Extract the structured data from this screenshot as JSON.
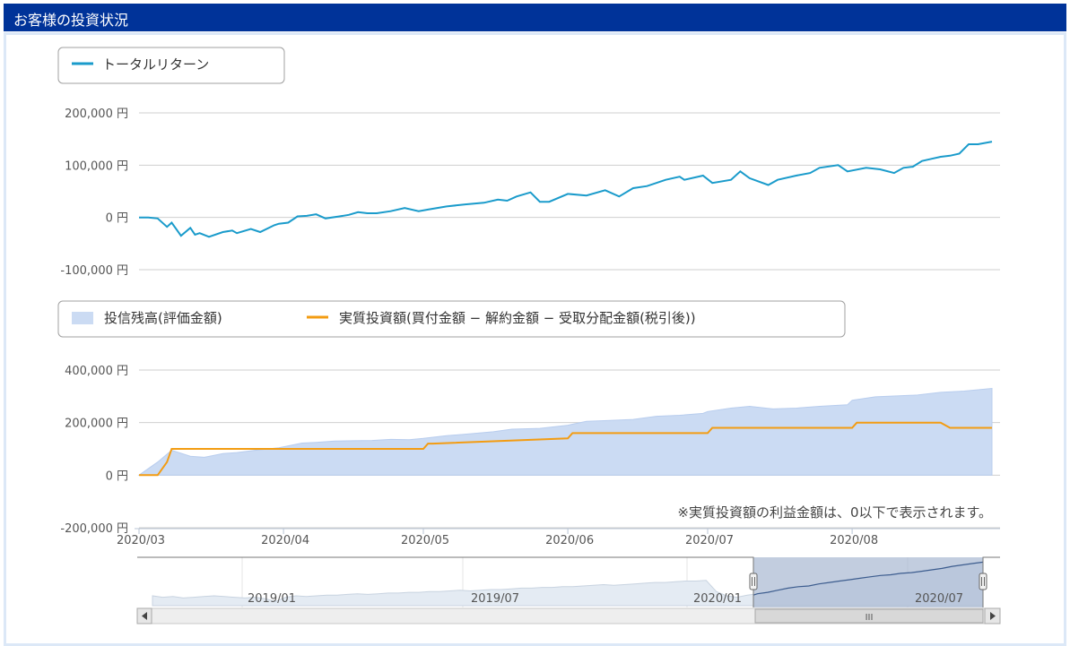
{
  "header": {
    "title": "お客様の投資状況"
  },
  "colors": {
    "header_bg": "#003399",
    "return_line": "#1a9bcb",
    "area_fill": "#cbdbf3",
    "net_line": "#f39c12"
  },
  "chart_data": [
    {
      "type": "line",
      "legend": [
        "トータルリターン"
      ],
      "y_ticks": [
        "200,000 円",
        "100,000 円",
        "0 円",
        "-100,000 円"
      ],
      "ylim": [
        -100000,
        200000
      ],
      "series": [
        {
          "name": "トータルリターン",
          "x": [
            "2020-03-01",
            "2020-03-03",
            "2020-03-05",
            "2020-03-07",
            "2020-03-08",
            "2020-03-10",
            "2020-03-12",
            "2020-03-13",
            "2020-03-14",
            "2020-03-16",
            "2020-03-19",
            "2020-03-21",
            "2020-03-22",
            "2020-03-25",
            "2020-03-27",
            "2020-03-30",
            "2020-03-31",
            "2020-04-02",
            "2020-04-04",
            "2020-04-06",
            "2020-04-08",
            "2020-04-10",
            "2020-04-13",
            "2020-04-15",
            "2020-04-17",
            "2020-04-19",
            "2020-04-21",
            "2020-04-24",
            "2020-04-27",
            "2020-04-30",
            "2020-05-02",
            "2020-05-06",
            "2020-05-10",
            "2020-05-14",
            "2020-05-17",
            "2020-05-19",
            "2020-05-21",
            "2020-05-24",
            "2020-05-26",
            "2020-05-28",
            "2020-06-01",
            "2020-06-05",
            "2020-06-09",
            "2020-06-12",
            "2020-06-15",
            "2020-06-18",
            "2020-06-22",
            "2020-06-25",
            "2020-06-26",
            "2020-06-30",
            "2020-07-02",
            "2020-07-06",
            "2020-07-08",
            "2020-07-10",
            "2020-07-14",
            "2020-07-16",
            "2020-07-20",
            "2020-07-23",
            "2020-07-25",
            "2020-07-29",
            "2020-07-31",
            "2020-08-04",
            "2020-08-07",
            "2020-08-10",
            "2020-08-12",
            "2020-08-14",
            "2020-08-16",
            "2020-08-18",
            "2020-08-20",
            "2020-08-22",
            "2020-08-24",
            "2020-08-26",
            "2020-08-28",
            "2020-08-31"
          ],
          "values": [
            0,
            0,
            -2000,
            -18000,
            -10000,
            -35000,
            -20000,
            -33000,
            -30000,
            -37000,
            -28000,
            -25000,
            -30000,
            -22000,
            -28000,
            -15000,
            -12000,
            -10000,
            2000,
            3000,
            6000,
            -2000,
            2000,
            5000,
            10000,
            8000,
            8000,
            12000,
            18000,
            12000,
            15000,
            21000,
            25000,
            28000,
            34000,
            32000,
            40000,
            48000,
            30000,
            30000,
            45000,
            42000,
            52000,
            40000,
            56000,
            60000,
            72000,
            78000,
            72000,
            80000,
            66000,
            72000,
            88000,
            75000,
            62000,
            72000,
            80000,
            85000,
            95000,
            100000,
            88000,
            95000,
            92000,
            85000,
            95000,
            97000,
            108000,
            112000,
            116000,
            118000,
            122000,
            140000,
            140000,
            145000
          ]
        }
      ]
    },
    {
      "type": "area",
      "legend": [
        "投信残高(評価金額)",
        "実質投資額(買付金額 − 解約金額 − 受取分配金額(税引後))"
      ],
      "y_ticks": [
        "400,000 円",
        "200,000 円",
        "0 円",
        "-200,000 円"
      ],
      "ylim": [
        -200000,
        400000
      ],
      "categories": [
        "2020/03",
        "2020/04",
        "2020/05",
        "2020/06",
        "2020/07",
        "2020/08"
      ],
      "note": "※実質投資額の利益金額は、0以下で表示されます。",
      "series": [
        {
          "name": "投信残高(評価金額)",
          "x": [
            "2020-03-01",
            "2020-03-05",
            "2020-03-08",
            "2020-03-12",
            "2020-03-15",
            "2020-03-19",
            "2020-03-22",
            "2020-03-26",
            "2020-03-31",
            "2020-04-05",
            "2020-04-08",
            "2020-04-12",
            "2020-04-16",
            "2020-04-20",
            "2020-04-24",
            "2020-04-28",
            "2020-05-01",
            "2020-05-06",
            "2020-05-10",
            "2020-05-16",
            "2020-05-20",
            "2020-05-26",
            "2020-06-01",
            "2020-06-05",
            "2020-06-10",
            "2020-06-15",
            "2020-06-20",
            "2020-06-25",
            "2020-06-30",
            "2020-07-01",
            "2020-07-06",
            "2020-07-10",
            "2020-07-15",
            "2020-07-20",
            "2020-07-25",
            "2020-07-31",
            "2020-08-01",
            "2020-08-06",
            "2020-08-10",
            "2020-08-15",
            "2020-08-20",
            "2020-08-25",
            "2020-08-31"
          ],
          "values": [
            0,
            50000,
            95000,
            72000,
            68000,
            82000,
            86000,
            95000,
            104000,
            122000,
            125000,
            130000,
            131000,
            132000,
            136000,
            135000,
            140000,
            150000,
            156000,
            165000,
            175000,
            178000,
            190000,
            205000,
            208000,
            212000,
            224000,
            228000,
            235000,
            242000,
            255000,
            262000,
            252000,
            255000,
            262000,
            268000,
            285000,
            298000,
            301000,
            305000,
            315000,
            320000,
            330000
          ]
        },
        {
          "name": "実質投資額(買付金額 − 解約金額 − 受取分配金額(税引後))",
          "x": [
            "2020-03-01",
            "2020-03-05",
            "2020-03-07",
            "2020-03-08",
            "2020-04-01",
            "2020-05-01",
            "2020-05-02",
            "2020-05-03",
            "2020-06-01",
            "2020-06-02",
            "2020-07-01",
            "2020-07-02",
            "2020-08-01",
            "2020-08-02",
            "2020-08-20",
            "2020-08-22",
            "2020-08-31"
          ],
          "values": [
            0,
            0,
            50000,
            100000,
            100000,
            100000,
            120000,
            120000,
            140000,
            160000,
            160000,
            180000,
            180000,
            200000,
            200000,
            180000,
            180000
          ]
        }
      ]
    }
  ],
  "navigator": {
    "labels": [
      "2019/01",
      "2019/07",
      "2020/01",
      "2020/07"
    ],
    "scroll_label": "III"
  }
}
